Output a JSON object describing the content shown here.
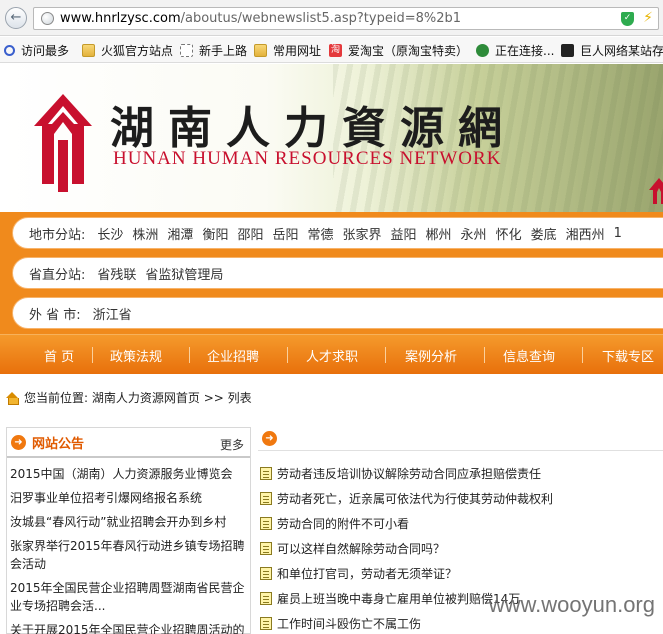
{
  "browser": {
    "url_host": "www.hnrlzysc.com",
    "url_path": "/aboutus/webnewslist5.asp?typeid=8%2b1",
    "bookmarks": [
      "访问最多",
      "火狐官方站点",
      "新手上路",
      "常用网址",
      "爱淘宝（原淘宝特卖）",
      "正在连接...",
      "巨人网络某站存"
    ],
    "taobao_badge": "淘"
  },
  "header": {
    "title": "湖南人力資源網",
    "subtitle": "HUNAN HUMAN RESOURCES NETWORK"
  },
  "stations": {
    "rows": [
      {
        "label": "地市分站:",
        "links": [
          "长沙",
          "株洲",
          "湘潭",
          "衡阳",
          "邵阳",
          "岳阳",
          "常德",
          "张家界",
          "益阳",
          "郴州",
          "永州",
          "怀化",
          "娄底",
          "湘西州",
          "1"
        ]
      },
      {
        "label": "省直分站:",
        "links": [
          "省残联",
          "省监狱管理局"
        ]
      },
      {
        "label": "外 省 市:",
        "links": [
          "浙江省"
        ]
      }
    ]
  },
  "nav": {
    "items": [
      "首 页",
      "政策法规",
      "企业招聘",
      "人才求职",
      "案例分析",
      "信息查询",
      "下载专区"
    ]
  },
  "breadcrumb": {
    "prefix": "您当前位置:",
    "home": "湖南人力资源网首页",
    "sep": ">>",
    "current": "列表"
  },
  "notices": {
    "title": "网站公告",
    "more": "更多",
    "items": [
      "2015中国（湖南）人力资源服务业博览会",
      "汨罗事业单位招考引爆网络报名系统",
      "汝城县“春风行动”就业招聘会开办到乡村",
      "张家界举行2015年春风行动进乡镇专场招聘会活动",
      "2015年全国民营企业招聘周暨湖南省民营企业专场招聘会活...",
      "关于开展2015年全国民营企业招聘周活动的"
    ]
  },
  "articles": {
    "items": [
      "劳动者违反培训协议解除劳动合同应承担赔偿责任",
      "劳动者死亡，近亲属可依法代为行使其劳动仲裁权利",
      "劳动合同的附件不可小看",
      "可以这样自然解除劳动合同吗？",
      "和单位打官司，劳动者无须举证？",
      "雇员上班当晚中毒身亡雇用单位被判赔偿14万",
      "工作时间斗殴伤亡不属工伤"
    ]
  },
  "watermark": "www.wooyun.org",
  "colors": {
    "accent": "#f0780f",
    "title_red": "#c8102e"
  }
}
